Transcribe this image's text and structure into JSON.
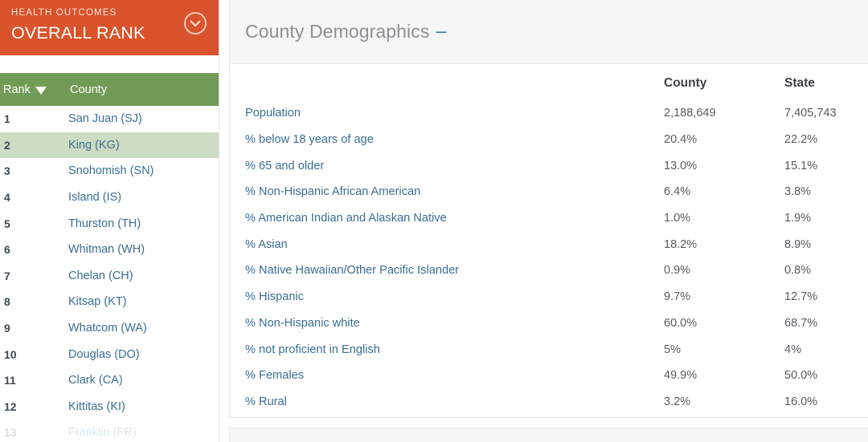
{
  "rank_panel": {
    "header": {
      "eyebrow": "HEALTH OUTCOMES",
      "title": "OVERALL RANK",
      "toggle_icon": "chevron-down-circle-icon"
    },
    "columns": {
      "rank": "Rank",
      "county": "County",
      "sort_icon": "sort-descending-caret-icon"
    },
    "rows": [
      {
        "rank": "1",
        "county": "San Juan (SJ)",
        "selected": false
      },
      {
        "rank": "2",
        "county": "King (KG)",
        "selected": true
      },
      {
        "rank": "3",
        "county": "Snohomish (SN)",
        "selected": false
      },
      {
        "rank": "4",
        "county": "Island (IS)",
        "selected": false
      },
      {
        "rank": "5",
        "county": "Thurston (TH)",
        "selected": false
      },
      {
        "rank": "6",
        "county": "Whitman (WH)",
        "selected": false
      },
      {
        "rank": "7",
        "county": "Chelan (CH)",
        "selected": false
      },
      {
        "rank": "8",
        "county": "Kitsap (KT)",
        "selected": false
      },
      {
        "rank": "9",
        "county": "Whatcom (WA)",
        "selected": false
      },
      {
        "rank": "10",
        "county": "Douglas (DO)",
        "selected": false
      },
      {
        "rank": "11",
        "county": "Clark (CA)",
        "selected": false
      },
      {
        "rank": "12",
        "county": "Kittitas (KI)",
        "selected": false
      },
      {
        "rank": "13",
        "county": "Franklin (FR)",
        "selected": false
      }
    ]
  },
  "demographics_card": {
    "title": "County Demographics",
    "collapse_label": "–",
    "headers": {
      "measure": "",
      "county": "County",
      "state": "State"
    },
    "rows": [
      {
        "label": "Population",
        "county": "2,188,649",
        "state": "7,405,743"
      },
      {
        "label": "% below 18 years of age",
        "county": "20.4%",
        "state": "22.2%"
      },
      {
        "label": "% 65 and older",
        "county": "13.0%",
        "state": "15.1%"
      },
      {
        "label": "% Non-Hispanic African American",
        "county": "6.4%",
        "state": "3.8%"
      },
      {
        "label": "% American Indian and Alaskan Native",
        "county": "1.0%",
        "state": "1.9%"
      },
      {
        "label": "% Asian",
        "county": "18.2%",
        "state": "8.9%"
      },
      {
        "label": "% Native Hawaiian/Other Pacific Islander",
        "county": "0.9%",
        "state": "0.8%"
      },
      {
        "label": "% Hispanic",
        "county": "9.7%",
        "state": "12.7%"
      },
      {
        "label": "% Non-Hispanic white",
        "county": "60.0%",
        "state": "68.7%"
      },
      {
        "label": "% not proficient in English",
        "county": "5%",
        "state": "4%"
      },
      {
        "label": "% Females",
        "county": "49.9%",
        "state": "50.0%"
      },
      {
        "label": "% Rural",
        "county": "3.2%",
        "state": "16.0%"
      }
    ]
  },
  "colors": {
    "header_orange": "#d9532c",
    "column_green": "#729b55",
    "selected_row": "#cedcc4",
    "link_blue": "#3b6e92",
    "collapse_teal": "#2c7b93",
    "card_header_gray": "#f5f6f6"
  }
}
